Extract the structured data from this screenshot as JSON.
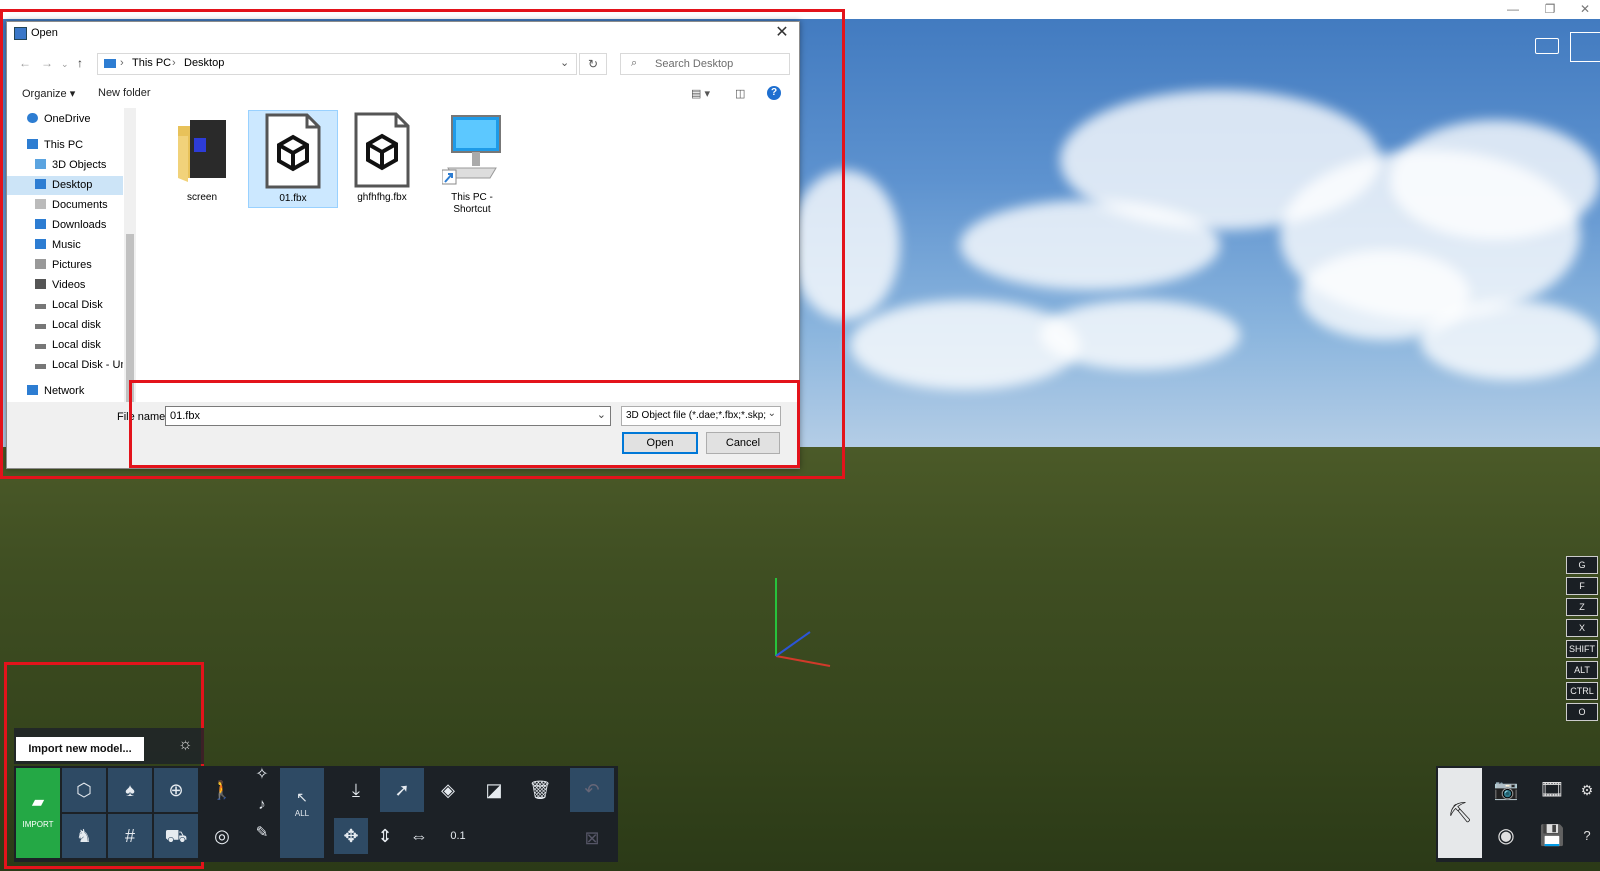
{
  "dialog": {
    "title": "Open",
    "close_icon": "close-icon",
    "breadcrumb": [
      "This PC",
      "Desktop"
    ],
    "search_placeholder": "Search Desktop",
    "organize_label": "Organize ▾",
    "new_folder_label": "New folder",
    "help_label": "?",
    "nav_items": [
      {
        "label": "OneDrive",
        "icon": "cloud-icon",
        "color": "#2d7dd2"
      },
      {
        "label": "This PC",
        "icon": "computer-icon",
        "color": "#2d7dd2"
      },
      {
        "label": "3D Objects",
        "icon": "cube-icon",
        "color": "#5ba4e0"
      },
      {
        "label": "Desktop",
        "icon": "desktop-icon",
        "color": "#2d7dd2",
        "selected": true
      },
      {
        "label": "Documents",
        "icon": "document-icon",
        "color": "#888888"
      },
      {
        "label": "Downloads",
        "icon": "download-icon",
        "color": "#2d7dd2"
      },
      {
        "label": "Music",
        "icon": "music-icon",
        "color": "#2d7dd2"
      },
      {
        "label": "Pictures",
        "icon": "pictures-icon",
        "color": "#888888"
      },
      {
        "label": "Videos",
        "icon": "video-icon",
        "color": "#555555"
      },
      {
        "label": "Local Disk",
        "icon": "disk-icon",
        "color": "#666666"
      },
      {
        "label": "Local disk",
        "icon": "disk-icon",
        "color": "#666666"
      },
      {
        "label": "Local disk",
        "icon": "disk-icon",
        "color": "#666666"
      },
      {
        "label": "Local Disk - Unla",
        "icon": "disk-icon",
        "color": "#666666"
      },
      {
        "label": "Network",
        "icon": "network-icon",
        "color": "#2d7dd2"
      }
    ],
    "files": [
      {
        "label": "screen",
        "type": "folder"
      },
      {
        "label": "01.fbx",
        "type": "fbx",
        "selected": true
      },
      {
        "label": "ghfhfhg.fbx",
        "type": "fbx"
      },
      {
        "label": "This PC - Shortcut",
        "type": "shortcut"
      }
    ],
    "filename_label": "File name:",
    "filename_value": "01.fbx",
    "filetype_value": "3D Object file (*.dae;*.fbx;*.skp;",
    "open_label": "Open",
    "cancel_label": "Cancel"
  },
  "app": {
    "tooltip": "Import new model...",
    "import_label": "IMPORT",
    "all_label": "ALL",
    "value_display": "0.1",
    "side_keys": [
      "G",
      "F",
      "Z",
      "X",
      "SHIFT",
      "ALT",
      "CTRL",
      "O"
    ],
    "help_label": "?"
  },
  "colors": {
    "highlight_red": "#e3131b",
    "import_green": "#24a845",
    "toolbar_bg": "#1c2126",
    "selection_blue": "#cce8ff"
  }
}
